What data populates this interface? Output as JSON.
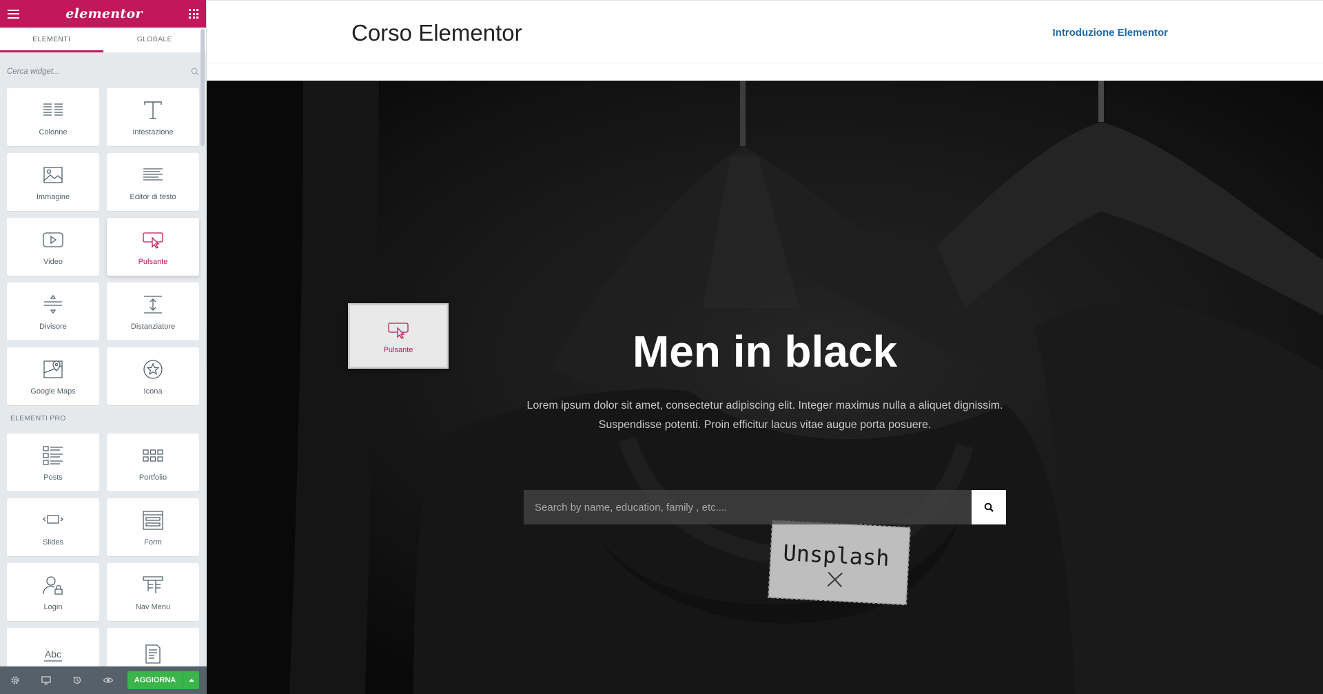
{
  "colors": {
    "brand": "#c2185b",
    "sidebar_bg": "#e6e9ec",
    "footer_bg": "#556068",
    "update_green": "#39b54a",
    "nav_link": "#1c69a8"
  },
  "panel": {
    "logo": "elementor",
    "tabs": [
      {
        "label": "ELEMENTI",
        "active": true
      },
      {
        "label": "GLOBALE",
        "active": false
      }
    ],
    "search_placeholder": "Cerca widget...",
    "basic_widgets": [
      {
        "label": "Colonne",
        "icon": "columns-icon"
      },
      {
        "label": "Intestazione",
        "icon": "heading-icon"
      },
      {
        "label": "Immagine",
        "icon": "image-icon"
      },
      {
        "label": "Editor di testo",
        "icon": "text-editor-icon"
      },
      {
        "label": "Video",
        "icon": "video-icon"
      },
      {
        "label": "Pulsante",
        "icon": "button-icon",
        "hovered": true
      },
      {
        "label": "Divisore",
        "icon": "divider-icon"
      },
      {
        "label": "Distanziatore",
        "icon": "spacer-icon"
      },
      {
        "label": "Google Maps",
        "icon": "google-maps-icon"
      },
      {
        "label": "Icona",
        "icon": "star-icon"
      }
    ],
    "pro_section_title": "ELEMENTI PRO",
    "pro_widgets": [
      {
        "label": "Posts",
        "icon": "posts-icon"
      },
      {
        "label": "Portfolio",
        "icon": "portfolio-icon"
      },
      {
        "label": "Slides",
        "icon": "slides-icon"
      },
      {
        "label": "Form",
        "icon": "form-icon"
      },
      {
        "label": "Login",
        "icon": "login-icon"
      },
      {
        "label": "Nav Menu",
        "icon": "nav-menu-icon"
      },
      {
        "label": "",
        "icon": "animated-headline-icon",
        "glyph": "Abc"
      },
      {
        "label": "",
        "icon": "price-list-icon"
      }
    ],
    "footer": {
      "update_label": "AGGIORNA"
    }
  },
  "site": {
    "title": "Corso Elementor",
    "nav_link": "Introduzione Elementor"
  },
  "hero": {
    "title": "Men in black",
    "text_line1": "Lorem ipsum dolor sit amet, consectetur adipiscing elit. Integer maximus nulla a aliquet dignissim.",
    "text_line2": "Suspendisse potenti. Proin efficitur lacus vitae augue porta posuere.",
    "search_placeholder": "Search by name, education, family , etc....",
    "label_text": "Unsplash"
  },
  "drag_ghost": {
    "label": "Pulsante"
  }
}
